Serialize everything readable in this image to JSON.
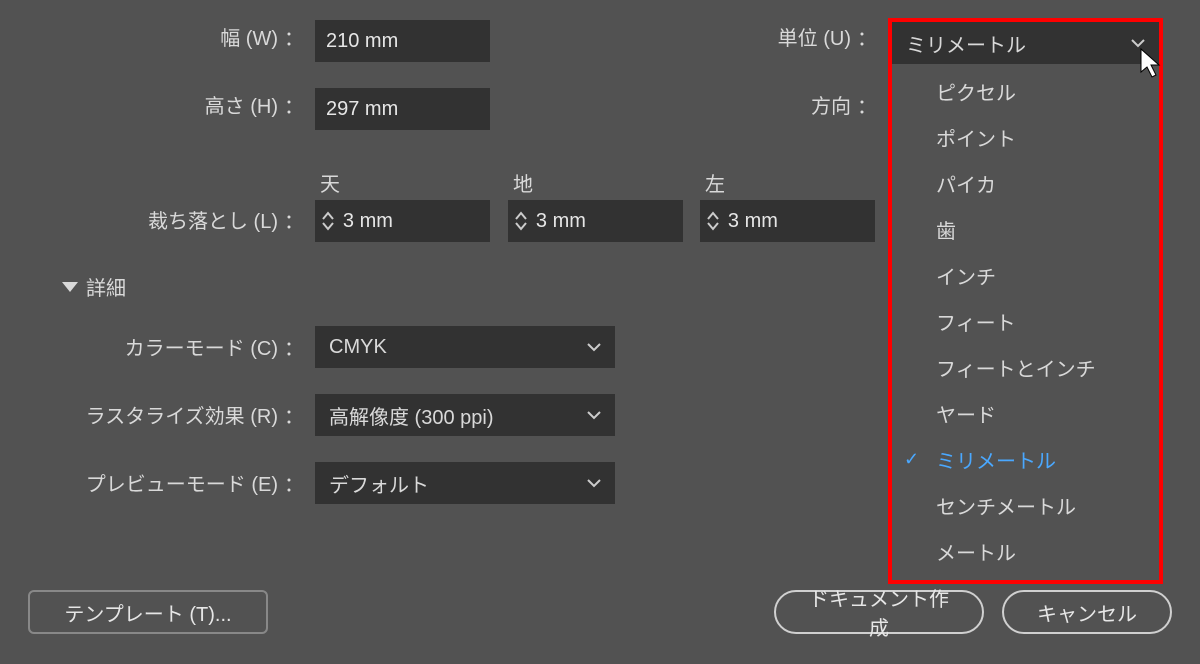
{
  "labels": {
    "width": "幅 (W)",
    "height": "高さ (H)",
    "unit": "単位 (U)",
    "orientation": "方向",
    "bleed": "裁ち落とし (L)",
    "top": "天",
    "bottom": "地",
    "left": "左",
    "advanced": "詳細",
    "colorMode": "カラーモード (C)",
    "rasterEffects": "ラスタライズ効果 (R)",
    "previewMode": "プレビューモード (E)"
  },
  "values": {
    "width": "210 mm",
    "height": "297 mm",
    "bleedTop": "3 mm",
    "bleedBottom": "3 mm",
    "bleedLeft": "3 mm",
    "colorMode": "CMYK",
    "rasterEffects": "高解像度 (300 ppi)",
    "previewMode": "デフォルト"
  },
  "unitDropdown": {
    "selected": "ミリメートル",
    "options": [
      "ピクセル",
      "ポイント",
      "パイカ",
      "歯",
      "インチ",
      "フィート",
      "フィートとインチ",
      "ヤード",
      "ミリメートル",
      "センチメートル",
      "メートル"
    ]
  },
  "buttons": {
    "template": "テンプレート (T)...",
    "create": "ドキュメント作成",
    "cancel": "キャンセル"
  }
}
